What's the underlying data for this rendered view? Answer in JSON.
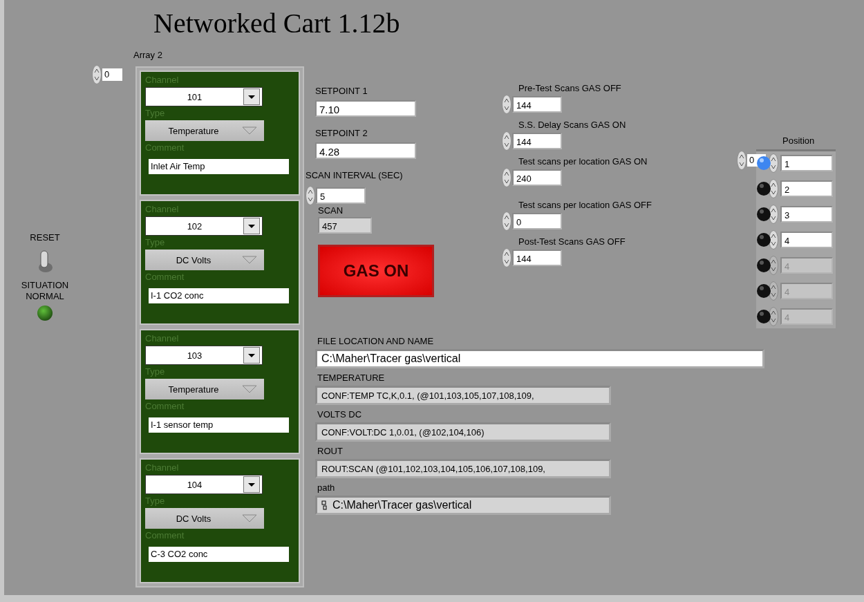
{
  "title": "Networked Cart 1.12b",
  "reset": {
    "label": "RESET",
    "on": false
  },
  "status": {
    "label": "SITUATION NORMAL",
    "on": true
  },
  "array": {
    "label": "Array 2",
    "index": "0",
    "items": [
      {
        "channel_label": "Channel",
        "channel": "101",
        "type_label": "Type",
        "type": "Temperature",
        "comment_label": "Comment",
        "comment": "Inlet Air Temp"
      },
      {
        "channel_label": "Channel",
        "channel": "102",
        "type_label": "Type",
        "type": "DC Volts",
        "comment_label": "Comment",
        "comment": "I-1 CO2 conc"
      },
      {
        "channel_label": "Channel",
        "channel": "103",
        "type_label": "Type",
        "type": "Temperature",
        "comment_label": "Comment",
        "comment": "I-1 sensor temp"
      },
      {
        "channel_label": "Channel",
        "channel": "104",
        "type_label": "Type",
        "type": "DC Volts",
        "comment_label": "Comment",
        "comment": "C-3 CO2 conc"
      }
    ]
  },
  "setpoints": [
    {
      "label": "SETPOINT 1",
      "value": "7.10"
    },
    {
      "label": "SETPOINT 2",
      "value": "4.28"
    }
  ],
  "scan_interval": {
    "label": "SCAN INTERVAL (SEC)",
    "value": "5"
  },
  "scan": {
    "label": "SCAN",
    "value": "457"
  },
  "gas_button": {
    "label": "GAS ON",
    "on": true
  },
  "scan_counts": [
    {
      "label": "Pre-Test Scans GAS OFF",
      "value": "144"
    },
    {
      "label": "S.S. Delay Scans GAS ON",
      "value": "144"
    },
    {
      "label": "Test scans per location GAS ON",
      "value": "240"
    },
    {
      "label": "Test scans per location GAS OFF",
      "value": "0"
    },
    {
      "label": "Post-Test Scans GAS OFF",
      "value": "144"
    }
  ],
  "position": {
    "label": "Position",
    "index": "0",
    "items": [
      {
        "value": "1",
        "on": true,
        "disabled": false
      },
      {
        "value": "2",
        "on": false,
        "disabled": false
      },
      {
        "value": "3",
        "on": false,
        "disabled": false
      },
      {
        "value": "4",
        "on": false,
        "disabled": false
      },
      {
        "value": "4",
        "on": false,
        "disabled": true
      },
      {
        "value": "4",
        "on": false,
        "disabled": true
      },
      {
        "value": "4",
        "on": false,
        "disabled": true
      }
    ]
  },
  "strings": [
    {
      "label": "FILE LOCATION AND NAME",
      "value": "C:\\Maher\\Tracer gas\\vertical",
      "kind": "control"
    },
    {
      "label": "TEMPERATURE",
      "value": "CONF:TEMP TC,K,0.1,  (@101,103,105,107,108,109,",
      "kind": "indicator"
    },
    {
      "label": "VOLTS DC",
      "value": "CONF:VOLT:DC 1,0.01, (@102,104,106)",
      "kind": "indicator"
    },
    {
      "label": "ROUT",
      "value": "ROUT:SCAN (@101,102,103,104,105,106,107,108,109,",
      "kind": "indicator"
    },
    {
      "label": "path",
      "value": "C:\\Maher\\Tracer gas\\vertical",
      "kind": "path"
    }
  ]
}
